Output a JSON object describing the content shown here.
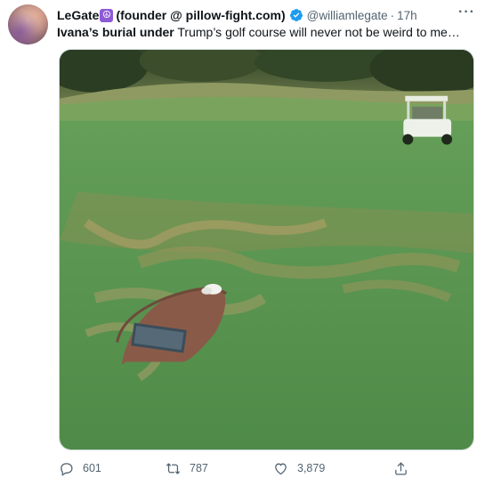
{
  "author": {
    "display_name": "LeGate",
    "badge_emoji": "☮",
    "name_suffix": " (founder @ pillow-fight.com)",
    "handle": "@williamlegate",
    "separator": "·",
    "time": "17h"
  },
  "tweet": {
    "text_bold": "Ivana’s burial under",
    "text_rest": " Trump’s golf course will never not be weird to me…"
  },
  "media": {
    "image_description": "golf-course-grave-photo",
    "plaque_text": ""
  },
  "actions": {
    "reply_count": "601",
    "retweet_count": "787",
    "like_count": "3,879"
  },
  "colors": {
    "verified_blue": "#1d9bf0",
    "meta_gray": "#536471",
    "badge_purple": "#8e5bd6"
  },
  "icons": {
    "more": "more-horizontal-icon",
    "verified": "verified-badge-icon",
    "reply": "reply-icon",
    "retweet": "retweet-icon",
    "like": "heart-icon",
    "share": "share-icon"
  }
}
